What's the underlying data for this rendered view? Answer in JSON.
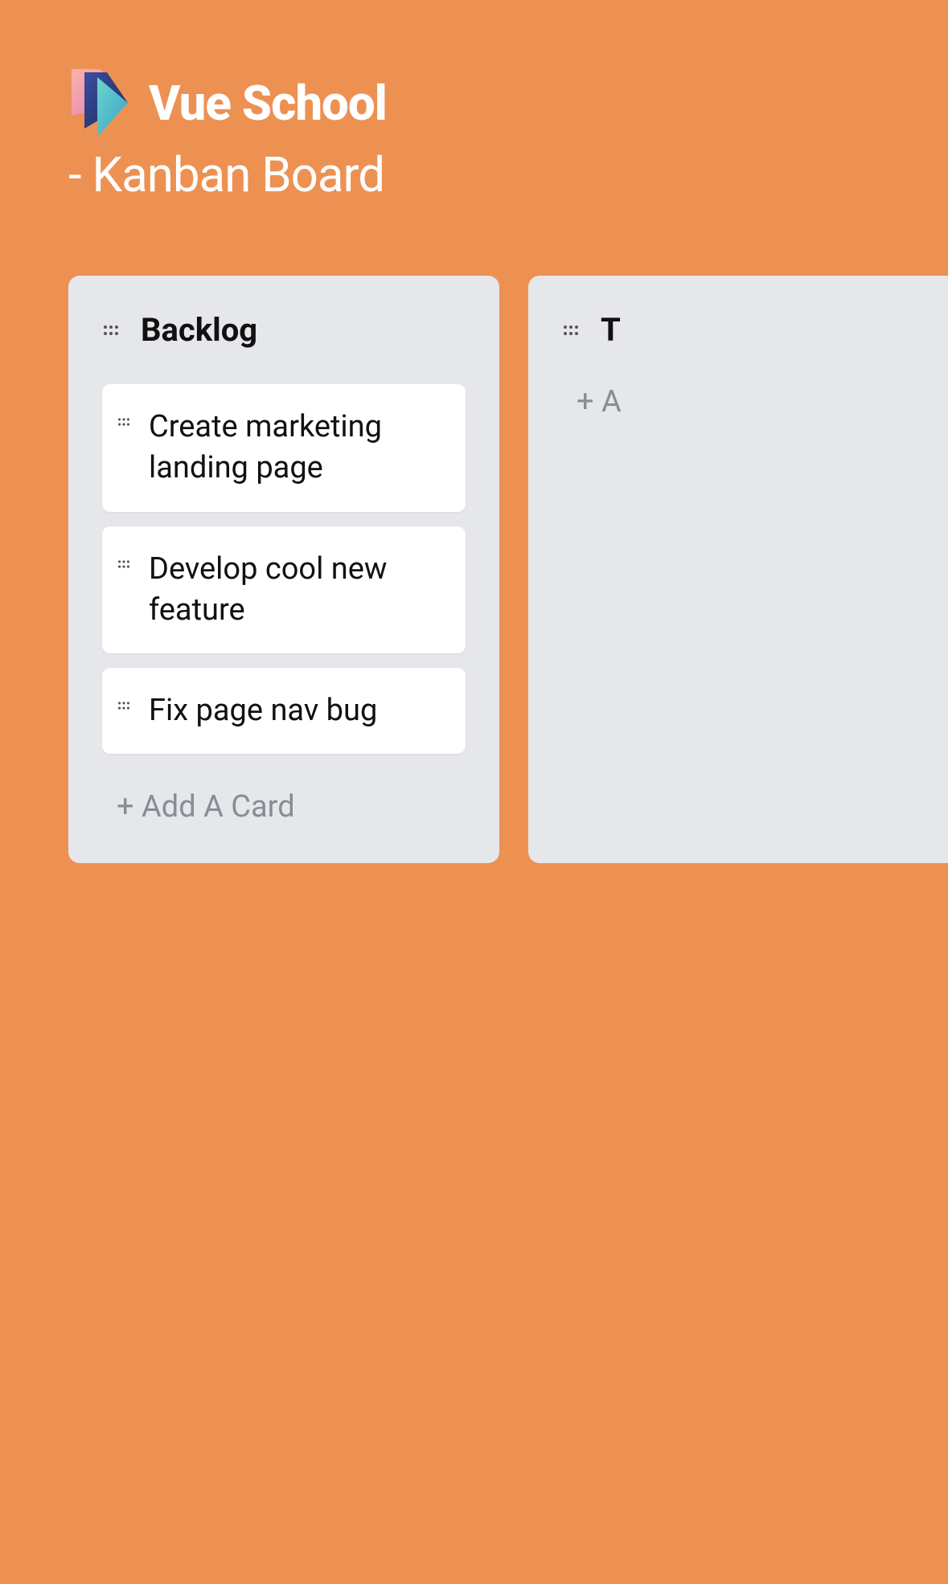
{
  "header": {
    "brand": "Vue School",
    "subtitle": "- Kanban Board"
  },
  "columns": [
    {
      "title": "Backlog",
      "cards": [
        {
          "text": "Create marketing landing page"
        },
        {
          "text": "Develop cool new feature"
        },
        {
          "text": "Fix page nav bug"
        }
      ],
      "add_card_label": "+ Add A Card"
    },
    {
      "title": "T",
      "cards": [],
      "add_card_label": "+ A"
    }
  ],
  "icons": {
    "drag": "drag-handle-icon"
  }
}
